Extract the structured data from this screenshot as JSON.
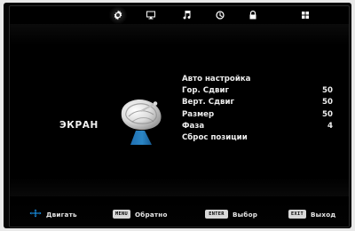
{
  "top_tabs": [
    {
      "icon": "gear-icon",
      "active": true
    },
    {
      "icon": "monitor-icon",
      "active": false
    },
    {
      "icon": "music-note-icon",
      "active": false
    },
    {
      "icon": "clock-icon",
      "active": false
    },
    {
      "icon": "lock-icon",
      "active": false
    },
    {
      "icon": "grid-icon",
      "active": false
    }
  ],
  "section": {
    "title": "ЭКРАН",
    "icon": "satellite-dish-icon"
  },
  "menu": {
    "items": [
      {
        "label": "Авто настройка",
        "value": ""
      },
      {
        "label": "Гор. Сдвиг",
        "value": "50"
      },
      {
        "label": "Верт. Сдвиг",
        "value": "50"
      },
      {
        "label": "Размер",
        "value": "50"
      },
      {
        "label": "Фаза",
        "value": "4"
      },
      {
        "label": "Сброс позиции",
        "value": ""
      }
    ]
  },
  "bottom_hints": [
    {
      "key": "",
      "label": "Двигать",
      "icon": "arrows-icon"
    },
    {
      "key": "MENU",
      "label": "Обратно"
    },
    {
      "key": "ENTER",
      "label": "Выбор"
    },
    {
      "key": "EXIT",
      "label": "Выход"
    }
  ],
  "colors": {
    "background": "#000000",
    "text": "#ededed",
    "dish_body": "#e6e6e6",
    "dish_base": "#2b86c5"
  }
}
